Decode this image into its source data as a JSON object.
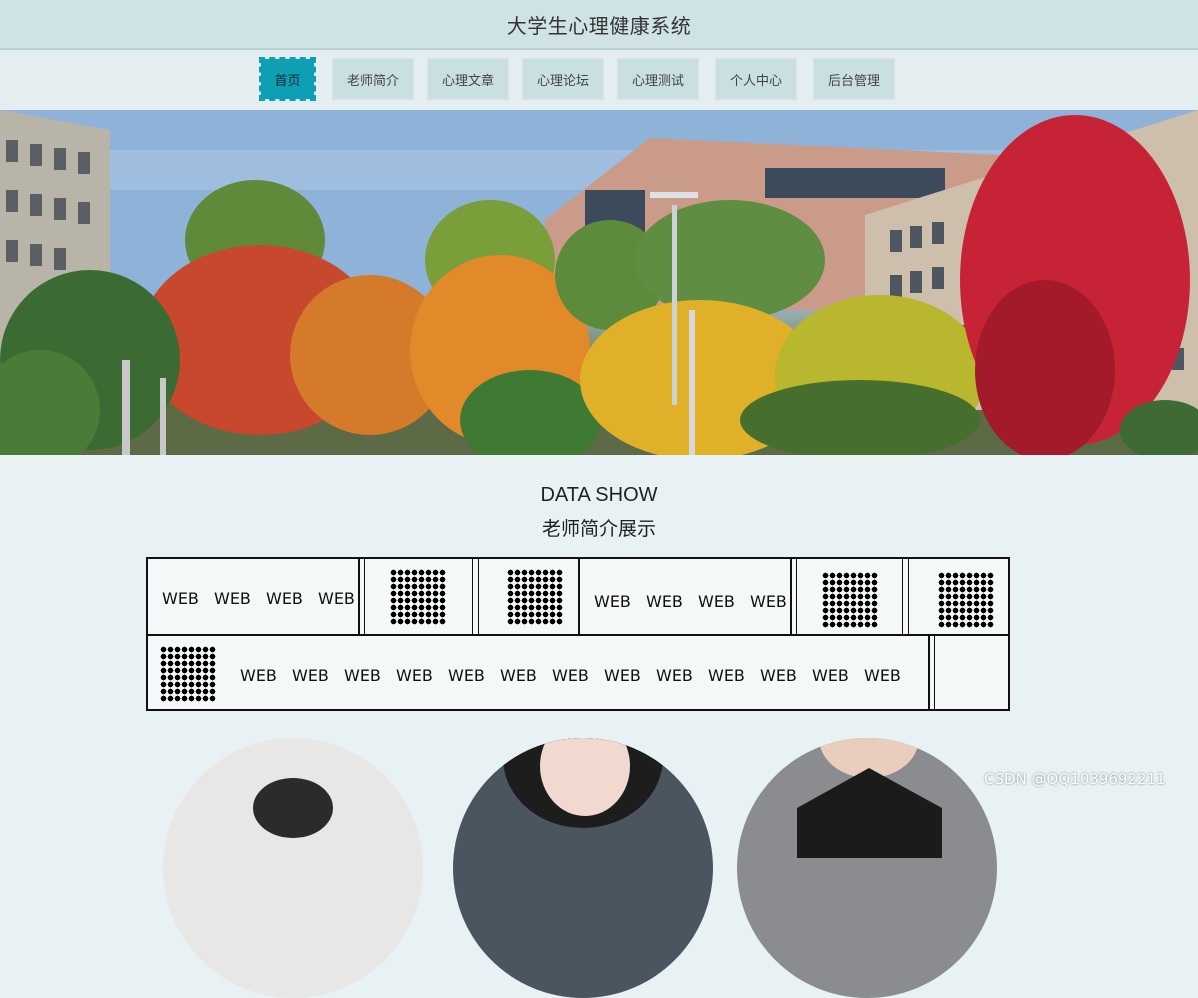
{
  "header": {
    "title": "大学生心理健康系统"
  },
  "nav": {
    "items": [
      {
        "label": "首页",
        "active": true
      },
      {
        "label": "老师简介"
      },
      {
        "label": "心理文章"
      },
      {
        "label": "心理论坛"
      },
      {
        "label": "心理测试"
      },
      {
        "label": "个人中心"
      },
      {
        "label": "后台管理"
      }
    ]
  },
  "section": {
    "title_en": "DATA SHOW",
    "title_cn": "老师简介展示"
  },
  "marquee": {
    "web_label": "WEB"
  },
  "watermark": "CSDN @QQ1039692211",
  "colors": {
    "accent": "#0f9fb4",
    "topbar": "#cfe3e6",
    "page_bg": "#e8f2f4"
  }
}
